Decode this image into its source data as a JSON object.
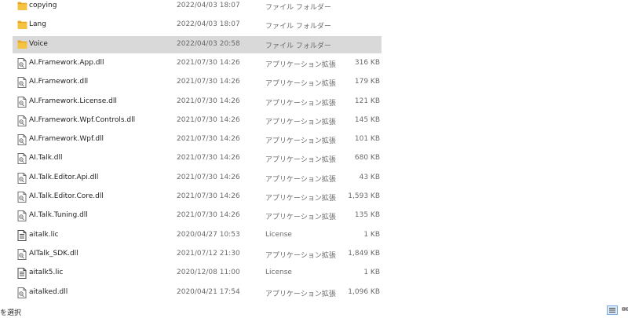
{
  "files": [
    {
      "name": "copying",
      "date": "2022/04/03 18:07",
      "type": "ファイル フォルダー",
      "size": "",
      "icon": "folder-icon",
      "selected": false
    },
    {
      "name": "Lang",
      "date": "2022/04/03 18:07",
      "type": "ファイル フォルダー",
      "size": "",
      "icon": "folder-icon",
      "selected": false
    },
    {
      "name": "Voice",
      "date": "2022/04/03 20:58",
      "type": "ファイル フォルダー",
      "size": "",
      "icon": "folder-icon",
      "selected": true
    },
    {
      "name": "AI.Framework.App.dll",
      "date": "2021/07/30 14:26",
      "type": "アプリケーション拡張",
      "size": "316 KB",
      "icon": "dll-file-icon",
      "selected": false
    },
    {
      "name": "AI.Framework.dll",
      "date": "2021/07/30 14:26",
      "type": "アプリケーション拡張",
      "size": "179 KB",
      "icon": "dll-file-icon",
      "selected": false
    },
    {
      "name": "AI.Framework.License.dll",
      "date": "2021/07/30 14:26",
      "type": "アプリケーション拡張",
      "size": "121 KB",
      "icon": "dll-file-icon",
      "selected": false
    },
    {
      "name": "AI.Framework.Wpf.Controls.dll",
      "date": "2021/07/30 14:26",
      "type": "アプリケーション拡張",
      "size": "145 KB",
      "icon": "dll-file-icon",
      "selected": false
    },
    {
      "name": "AI.Framework.Wpf.dll",
      "date": "2021/07/30 14:26",
      "type": "アプリケーション拡張",
      "size": "101 KB",
      "icon": "dll-file-icon",
      "selected": false
    },
    {
      "name": "AI.Talk.dll",
      "date": "2021/07/30 14:26",
      "type": "アプリケーション拡張",
      "size": "680 KB",
      "icon": "dll-file-icon",
      "selected": false
    },
    {
      "name": "AI.Talk.Editor.Api.dll",
      "date": "2021/07/30 14:26",
      "type": "アプリケーション拡張",
      "size": "43 KB",
      "icon": "dll-file-icon",
      "selected": false
    },
    {
      "name": "AI.Talk.Editor.Core.dll",
      "date": "2021/07/30 14:26",
      "type": "アプリケーション拡張",
      "size": "1,593 KB",
      "icon": "dll-file-icon",
      "selected": false
    },
    {
      "name": "AI.Talk.Tuning.dll",
      "date": "2021/07/30 14:26",
      "type": "アプリケーション拡張",
      "size": "135 KB",
      "icon": "dll-file-icon",
      "selected": false
    },
    {
      "name": "aitalk.lic",
      "date": "2020/04/27 10:53",
      "type": "License",
      "size": "1 KB",
      "icon": "license-file-icon",
      "selected": false
    },
    {
      "name": "AITalk_SDK.dll",
      "date": "2021/07/12 21:30",
      "type": "アプリケーション拡張",
      "size": "1,849 KB",
      "icon": "dll-file-icon",
      "selected": false
    },
    {
      "name": "aitalk5.lic",
      "date": "2020/12/08 11:00",
      "type": "License",
      "size": "1 KB",
      "icon": "license-file-icon",
      "selected": false
    },
    {
      "name": "aitalked.dll",
      "date": "2020/04/21 17:54",
      "type": "アプリケーション拡張",
      "size": "1,096 KB",
      "icon": "dll-file-icon",
      "selected": false
    }
  ],
  "status_bar": {
    "text": "を選択",
    "details_view_icon": "details-view-icon",
    "tiles_view_icon": "large-icons-view-icon"
  },
  "colors": {
    "folder": "#f5c342",
    "selected_row": "#d9d9d9",
    "secondary_text": "#6a6a6a"
  }
}
